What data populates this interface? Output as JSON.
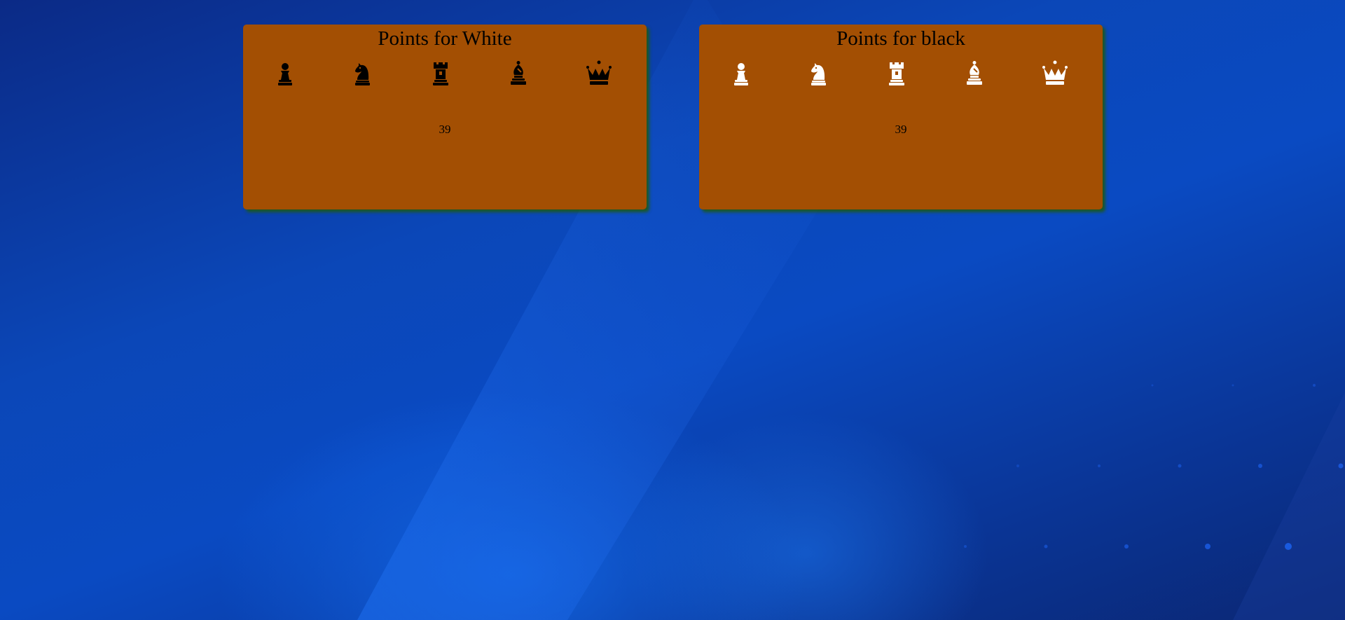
{
  "panels": {
    "white": {
      "title": "Points for White",
      "score": "39",
      "piece_color": "#000000",
      "pieces": [
        "pawn-icon",
        "knight-icon",
        "rook-icon",
        "bishop-icon",
        "queen-icon"
      ]
    },
    "black": {
      "title": "Points for black",
      "score": "39",
      "piece_color": "#ffffff",
      "pieces": [
        "pawn-icon",
        "knight-icon",
        "rook-icon",
        "bishop-icon",
        "queen-icon"
      ]
    }
  },
  "colors": {
    "panel_background": "#a34f03",
    "panel_shadow": "#1e5a14",
    "page_background": "#0a3a9a"
  }
}
